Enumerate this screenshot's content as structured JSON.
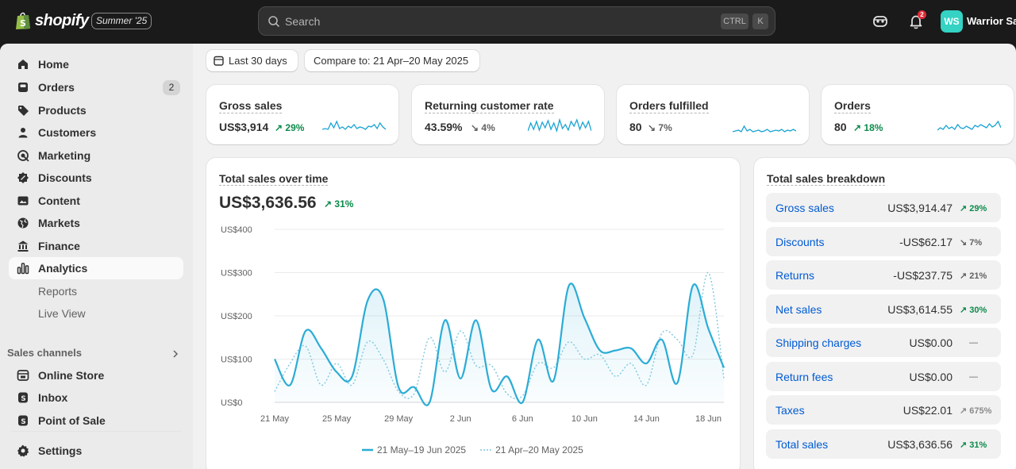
{
  "topbar": {
    "brand": "shopify",
    "edition": "Summer '25",
    "search_placeholder": "Search",
    "shortcut_1": "CTRL",
    "shortcut_2": "K",
    "notification_count": "2",
    "avatar_initials": "WS",
    "store_name": "Warrior Sa"
  },
  "sidebar": {
    "items": [
      {
        "label": "Home",
        "icon": "home-icon"
      },
      {
        "label": "Orders",
        "icon": "orders-icon",
        "badge": "2"
      },
      {
        "label": "Products",
        "icon": "tag-icon"
      },
      {
        "label": "Customers",
        "icon": "person-icon"
      },
      {
        "label": "Marketing",
        "icon": "target-icon"
      },
      {
        "label": "Discounts",
        "icon": "discount-icon"
      },
      {
        "label": "Content",
        "icon": "image-icon"
      },
      {
        "label": "Markets",
        "icon": "globe-icon"
      },
      {
        "label": "Finance",
        "icon": "bank-icon"
      },
      {
        "label": "Analytics",
        "icon": "bar-chart-icon",
        "active": true
      },
      {
        "label": "Reports"
      },
      {
        "label": "Live View"
      }
    ],
    "sales_channels_label": "Sales channels",
    "channels": [
      {
        "label": "Online Store",
        "icon": "store-icon"
      },
      {
        "label": "Inbox",
        "icon": "inbox-icon"
      },
      {
        "label": "Point of Sale",
        "icon": "pos-icon"
      }
    ],
    "settings_label": "Settings"
  },
  "filters": {
    "date_range": "Last 30 days",
    "compare": "Compare to: 21 Apr–20 May 2025"
  },
  "metrics": [
    {
      "title": "Gross sales",
      "value": "US$3,914",
      "delta": "29%",
      "direction": "up",
      "spark": [
        0.3,
        0.35,
        0.3,
        0.7,
        0.4,
        0.8,
        0.35,
        0.45,
        0.3,
        0.5,
        0.4,
        0.6,
        0.35,
        0.45,
        0.4,
        0.3,
        0.5,
        0.45,
        0.6,
        0.35,
        0.7,
        0.45,
        0.3
      ]
    },
    {
      "title": "Returning customer rate",
      "value": "43.59%",
      "delta": "4%",
      "direction": "down",
      "spark": [
        0.2,
        0.7,
        0.3,
        0.8,
        0.25,
        0.75,
        0.4,
        0.85,
        0.3,
        0.7,
        0.2,
        0.9,
        0.35,
        0.6,
        0.25,
        0.8,
        0.5,
        0.9,
        0.3,
        0.75,
        0.4,
        0.8,
        0.2
      ]
    },
    {
      "title": "Orders fulfilled",
      "value": "80",
      "delta": "7%",
      "direction": "down",
      "spark": [
        0.15,
        0.2,
        0.25,
        0.15,
        0.5,
        0.2,
        0.3,
        0.15,
        0.2,
        0.25,
        0.15,
        0.2,
        0.3,
        0.15,
        0.2,
        0.25,
        0.2,
        0.3,
        0.15,
        0.25,
        0.2,
        0.3,
        0.2
      ]
    },
    {
      "title": "Orders",
      "value": "80",
      "delta": "18%",
      "direction": "up",
      "spark": [
        0.25,
        0.4,
        0.3,
        0.55,
        0.35,
        0.45,
        0.3,
        0.6,
        0.4,
        0.35,
        0.5,
        0.4,
        0.3,
        0.55,
        0.45,
        0.6,
        0.5,
        0.4,
        0.65,
        0.45,
        0.55,
        0.8,
        0.4
      ]
    }
  ],
  "sales_over_time": {
    "title": "Total sales over time",
    "value": "US$3,636.56",
    "delta": "31%"
  },
  "chart_data": {
    "type": "line",
    "title": "Total sales over time",
    "x": [
      "21 May",
      "22 May",
      "23 May",
      "24 May",
      "25 May",
      "26 May",
      "27 May",
      "28 May",
      "29 May",
      "30 May",
      "31 May",
      "1 Jun",
      "2 Jun",
      "3 Jun",
      "4 Jun",
      "5 Jun",
      "6 Jun",
      "7 Jun",
      "8 Jun",
      "9 Jun",
      "10 Jun",
      "11 Jun",
      "12 Jun",
      "13 Jun",
      "14 Jun",
      "15 Jun",
      "16 Jun",
      "17 Jun",
      "18 Jun",
      "19 Jun"
    ],
    "xticks": [
      "21 May",
      "25 May",
      "29 May",
      "2 Jun",
      "6 Jun",
      "10 Jun",
      "14 Jun",
      "18 Jun"
    ],
    "yticks": [
      "US$0",
      "US$100",
      "US$200",
      "US$300",
      "US$400"
    ],
    "ylim": [
      0,
      400
    ],
    "series": [
      {
        "name": "21 May–19 Jun 2025",
        "style": "solid",
        "values": [
          100,
          40,
          165,
          125,
          70,
          60,
          235,
          240,
          35,
          35,
          0,
          190,
          55,
          190,
          30,
          60,
          0,
          145,
          50,
          270,
          195,
          120,
          120,
          125,
          90,
          145,
          45,
          270,
          170,
          80
        ]
      },
      {
        "name": "21 Apr–20 May 2025",
        "style": "dotted",
        "values": [
          25,
          90,
          130,
          40,
          90,
          40,
          140,
          100,
          25,
          20,
          150,
          70,
          165,
          85,
          85,
          20,
          15,
          90,
          80,
          140,
          100,
          110,
          60,
          90,
          40,
          160,
          145,
          110,
          300,
          55
        ]
      }
    ],
    "colors": {
      "current": "#2bacd6",
      "previous": "#7fc8df"
    },
    "legend": "bottom"
  },
  "breakdown": {
    "title": "Total sales breakdown",
    "rows": [
      {
        "label": "Gross sales",
        "value": "US$3,914.47",
        "delta": "29%",
        "direction": "up"
      },
      {
        "label": "Discounts",
        "value": "-US$62.17",
        "delta": "7%",
        "direction": "down"
      },
      {
        "label": "Returns",
        "value": "-US$237.75",
        "delta": "21%",
        "direction": "flat-up"
      },
      {
        "label": "Net sales",
        "value": "US$3,614.55",
        "delta": "30%",
        "direction": "up"
      },
      {
        "label": "Shipping charges",
        "value": "US$0.00",
        "delta": "—",
        "direction": "none"
      },
      {
        "label": "Return fees",
        "value": "US$0.00",
        "delta": "—",
        "direction": "none"
      },
      {
        "label": "Taxes",
        "value": "US$22.01",
        "delta": "675%",
        "direction": "neutral-up"
      },
      {
        "label": "Total sales",
        "value": "US$3,636.56",
        "delta": "31%",
        "direction": "up"
      }
    ]
  }
}
